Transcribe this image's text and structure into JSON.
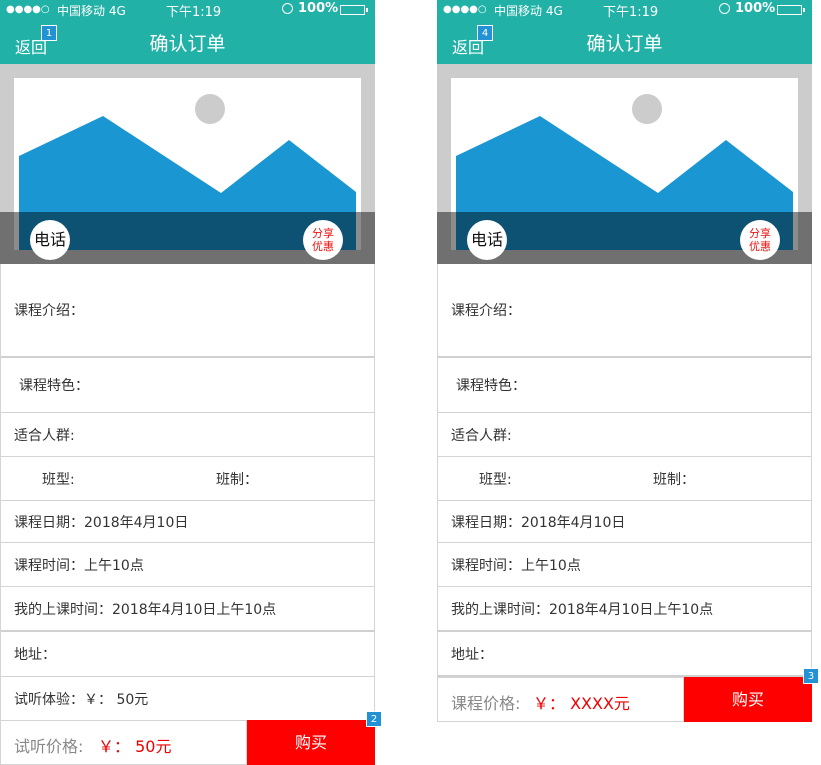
{
  "colors": {
    "header": "#21b1a6",
    "accent_red": "#ff0000",
    "price_red": "#ee0000",
    "marker_blue": "#2292d4"
  },
  "status_bar": {
    "signal": "●●●●○",
    "carrier": "中国移动  4G",
    "time": "下午1:19",
    "battery": "100%"
  },
  "screens": [
    {
      "nav": {
        "back_label": "返回",
        "back_marker": "1",
        "title": "确认订单"
      },
      "banner": {
        "phone_label": "电话",
        "share_label_1": "分享",
        "share_label_2": "优惠"
      },
      "rows": {
        "intro": "课程介绍：",
        "features": "课程特色：",
        "audience": "适合人群:",
        "class_type": "班型:",
        "class_system": "班制：",
        "course_date": "课程日期：2018年4月10日",
        "course_time": "课程时间：上午10点",
        "my_time": "我的上课时间：2018年4月10日上午10点",
        "address": "地址：",
        "trial": "试听体验：￥：  50元"
      },
      "bottom": {
        "price_label": "试听价格:",
        "price_value": "￥：  50元",
        "buy_label": "购买",
        "marker": "2"
      }
    },
    {
      "nav": {
        "back_label": "返回",
        "back_marker": "4",
        "title": "确认订单"
      },
      "banner": {
        "phone_label": "电话",
        "share_label_1": "分享",
        "share_label_2": "优惠"
      },
      "rows": {
        "intro": "课程介绍：",
        "features": "课程特色：",
        "audience": "适合人群:",
        "class_type": "班型:",
        "class_system": "班制：",
        "course_date": "课程日期：2018年4月10日",
        "course_time": "课程时间：上午10点",
        "my_time": "我的上课时间：2018年4月10日上午10点",
        "address": "地址："
      },
      "bottom": {
        "price_label": "课程价格:",
        "price_value": "￥：  XXXX元",
        "buy_label": "购买",
        "marker": "3"
      }
    }
  ]
}
